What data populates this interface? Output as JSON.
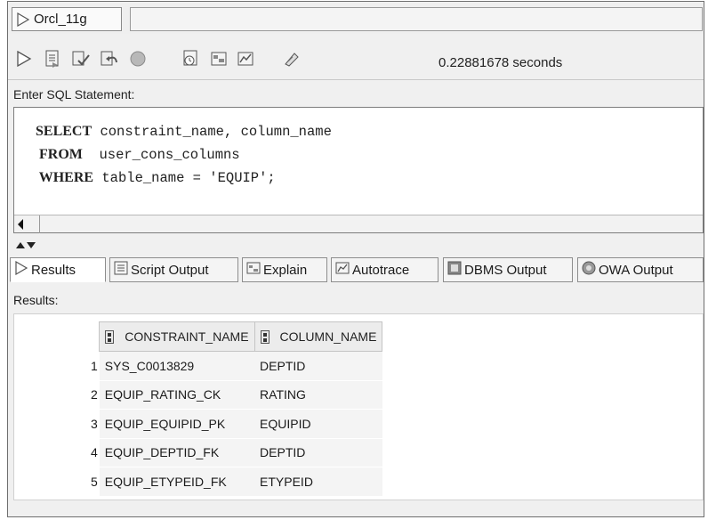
{
  "connection": {
    "tab_label": "Orcl_11g"
  },
  "toolbar": {
    "timing": "0.22881678 seconds",
    "icons": [
      "run-statement-icon",
      "run-script-icon",
      "commit-icon",
      "rollback-icon",
      "cancel-icon",
      "sql-history-icon",
      "explain-plan-icon",
      "autotrace-icon",
      "clear-icon"
    ]
  },
  "editor": {
    "label": "Enter SQL Statement:",
    "lines": [
      {
        "kw": "SELECT",
        "rest": " constraint_name, column_name"
      },
      {
        "kw": " FROM",
        "rest": "  user_cons_columns"
      },
      {
        "kw": " WHERE",
        "rest": " table_name = 'EQUIP';"
      }
    ]
  },
  "result_tabs": [
    "Results",
    "Script Output",
    "Explain",
    "Autotrace",
    "DBMS Output",
    "OWA Output"
  ],
  "results": {
    "label": "Results:",
    "columns": [
      "CONSTRAINT_NAME",
      "COLUMN_NAME"
    ],
    "rows": [
      {
        "n": "1",
        "constraint": "SYS_C0013829",
        "column": "DEPTID"
      },
      {
        "n": "2",
        "constraint": "EQUIP_RATING_CK",
        "column": "RATING"
      },
      {
        "n": "3",
        "constraint": "EQUIP_EQUIPID_PK",
        "column": "EQUIPID"
      },
      {
        "n": "4",
        "constraint": "EQUIP_DEPTID_FK",
        "column": "DEPTID"
      },
      {
        "n": "5",
        "constraint": "EQUIP_ETYPEID_FK",
        "column": "ETYPEID"
      }
    ]
  },
  "colors": {
    "frame": "#6e6e6e",
    "panel": "#f0f0f0",
    "row": "#f4f4f4"
  }
}
